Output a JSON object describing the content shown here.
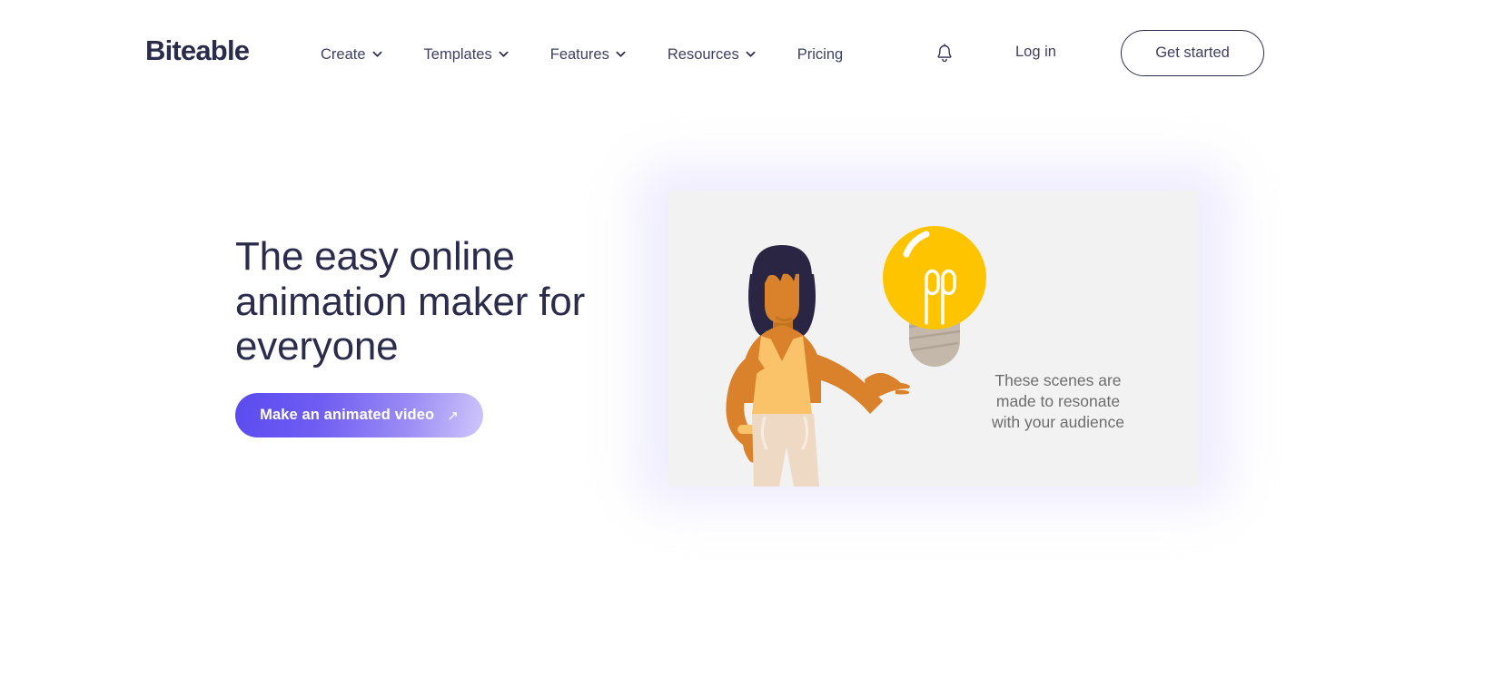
{
  "brand": {
    "logo_text": "Biteable",
    "logo_color": "#2b2c4b"
  },
  "header": {
    "nav_items": [
      {
        "label": "Create",
        "has_dropdown": true
      },
      {
        "label": "Templates",
        "has_dropdown": true
      },
      {
        "label": "Features",
        "has_dropdown": true
      },
      {
        "label": "Resources",
        "has_dropdown": true
      },
      {
        "label": "Pricing",
        "has_dropdown": false
      }
    ],
    "notification_icon": "bell-icon",
    "login_label": "Log in",
    "get_started_label": "Get started",
    "ghost_text": ""
  },
  "hero": {
    "headline": "The easy online animation maker for everyone",
    "cta_label": "Make an animated video",
    "cta_arrow": "↗",
    "cta_gradient_start": "#5b4bf0",
    "cta_gradient_end": "#cfc6fb"
  },
  "preview_card": {
    "background": "#f2f2f2",
    "glow_color": "#e9e6fd",
    "caption_line_1": "These scenes are",
    "caption_line_2": "made to resonate",
    "caption_line_3": "with your audience",
    "caption_color": "#6d6d6d",
    "illustration": {
      "name": "woman-holding-lightbulb",
      "bulb_color": "#ffc400",
      "bulb_base_color": "#c4b8ab",
      "hair_color": "#2b2544",
      "skin_color": "#d9822b",
      "top_color": "#fbc369",
      "pants_color": "#edd9c4"
    }
  }
}
